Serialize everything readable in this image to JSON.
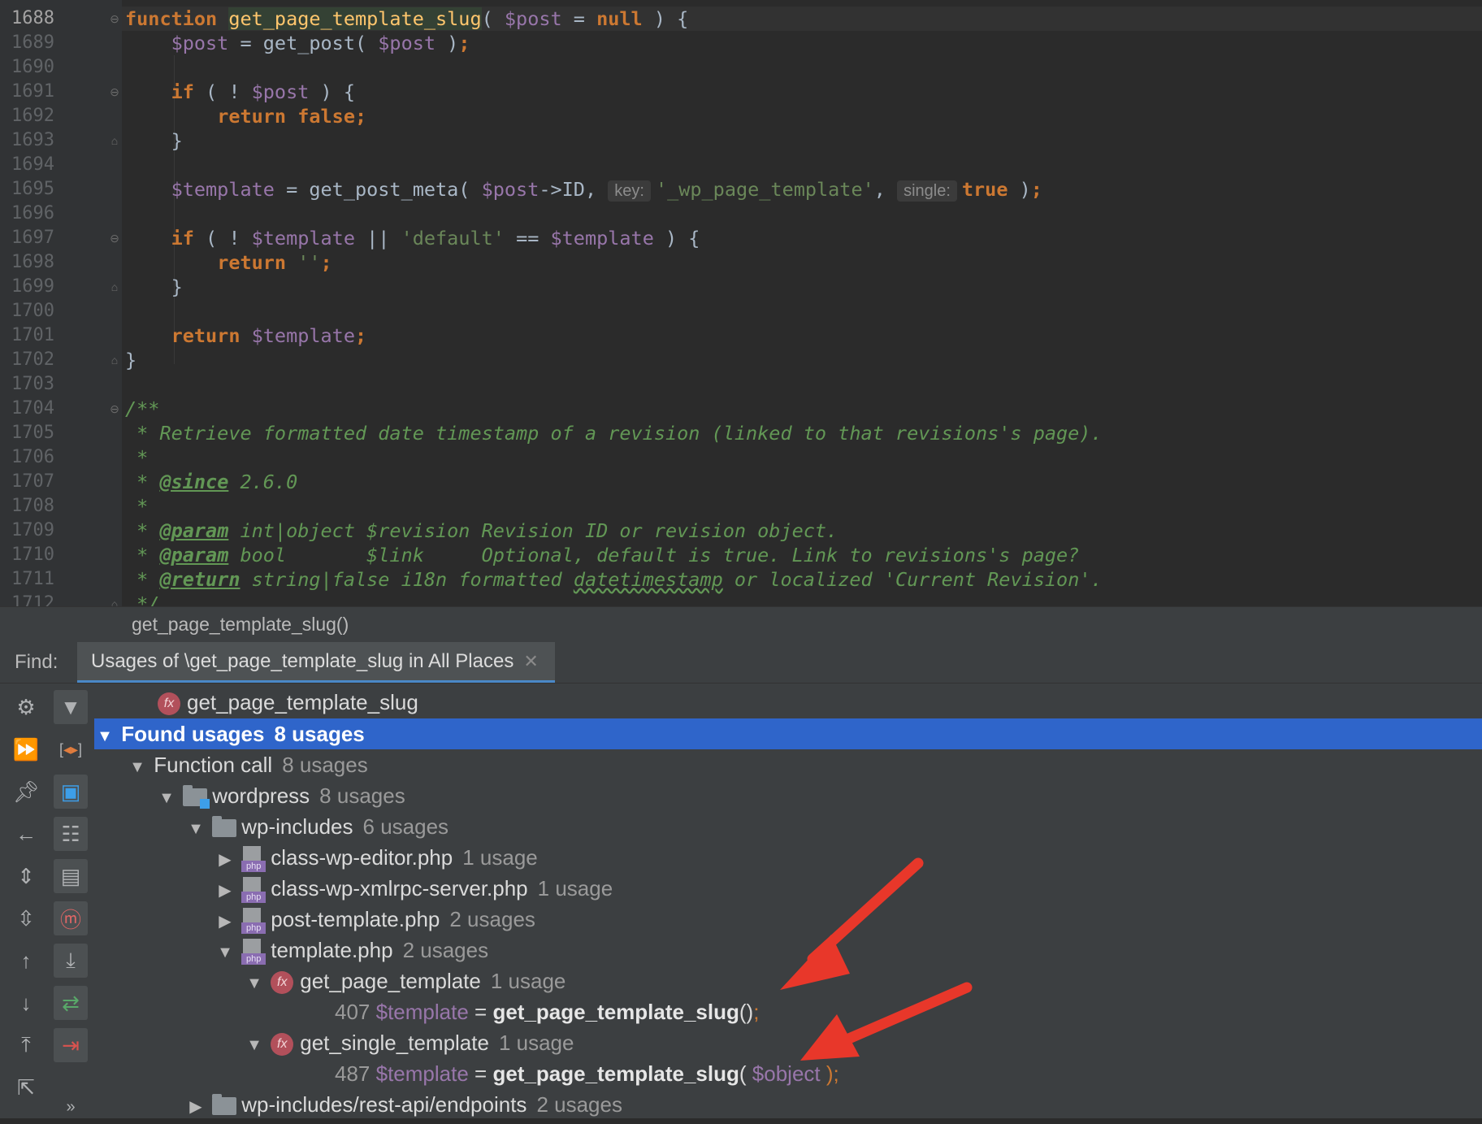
{
  "editor": {
    "line_numbers": [
      "1688",
      "1689",
      "1690",
      "1691",
      "1692",
      "1693",
      "1694",
      "1695",
      "1696",
      "1697",
      "1698",
      "1699",
      "1700",
      "1701",
      "1702",
      "1703",
      "1704",
      "1705",
      "1706",
      "1707",
      "1708",
      "1709",
      "1710",
      "1711",
      "1712"
    ],
    "inlay_hints": {
      "key": "key:",
      "single": "single:"
    }
  },
  "breadcrumb": {
    "label": "get_page_template_slug()"
  },
  "find": {
    "label": "Find:",
    "tab_title": "Usages of \\get_page_template_slug in All Places",
    "tree": {
      "root_function": "get_page_template_slug",
      "found_usages": {
        "label": "Found usages",
        "count": "8 usages"
      },
      "function_call": {
        "label": "Function call",
        "count": "8 usages"
      },
      "wordpress": {
        "label": "wordpress",
        "count": "8 usages"
      },
      "wp_includes": {
        "label": "wp-includes",
        "count": "6 usages"
      },
      "files": [
        {
          "name": "class-wp-editor.php",
          "count": "1 usage"
        },
        {
          "name": "class-wp-xmlrpc-server.php",
          "count": "1 usage"
        },
        {
          "name": "post-template.php",
          "count": "2 usages"
        },
        {
          "name": "template.php",
          "count": "2 usages"
        }
      ],
      "functions": [
        {
          "name": "get_page_template",
          "count": "1 usage",
          "line": "407",
          "var": "$template",
          "eq": " = ",
          "call": "get_page_template_slug",
          "args": "()",
          "arg_var": "",
          "end": ";"
        },
        {
          "name": "get_single_template",
          "count": "1 usage",
          "line": "487",
          "var": "$template",
          "eq": " = ",
          "call": "get_page_template_slug",
          "args": "( ",
          "arg_var": "$object",
          "end": " );"
        }
      ],
      "rest_api": {
        "label": "wp-includes/rest-api/endpoints",
        "count": "2 usages"
      }
    }
  },
  "icons": {
    "toolbar": [
      "gear-icon",
      "filter-icon",
      "rerun-icon",
      "merge-icon",
      "pin-icon",
      "preview-icon",
      "back-icon",
      "group-by-module-icon",
      "expand-all-icon",
      "group-by-directory-icon",
      "collapse-all-icon",
      "group-by-file-structure-icon",
      "up-icon",
      "autoscroll-to-source-icon",
      "down-icon",
      "autoscroll-from-source-icon",
      "export-icon",
      "close-usages-icon",
      "open-in-new-tab-icon",
      "more-icon"
    ]
  },
  "colors": {
    "selection": "#2f65ca",
    "keyword": "#cc7832",
    "variable": "#9876aa",
    "string": "#6a8759",
    "doc_comment": "#629755",
    "annotation_arrow": "#e8372a"
  }
}
